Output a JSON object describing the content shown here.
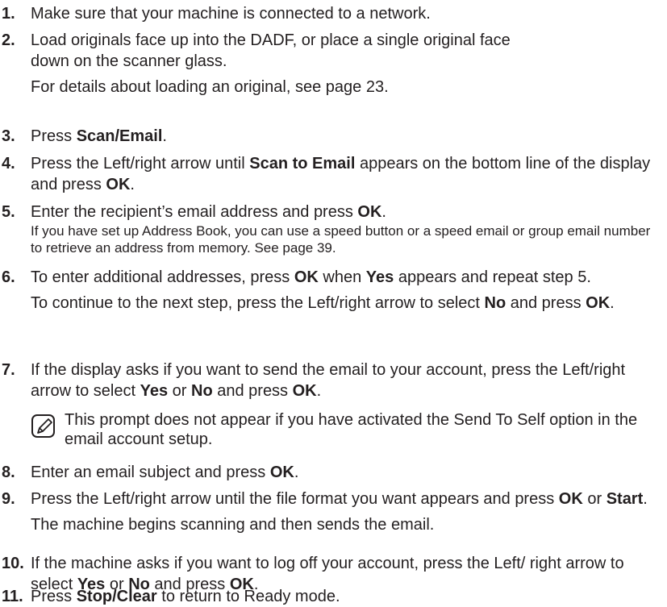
{
  "steps": [
    {
      "number": "1.",
      "text": "Make sure that your machine is connected to a network."
    },
    {
      "number": "2.",
      "line1": "Load originals face up into the DADF, or place a single original face",
      "line2": "down on the scanner glass.",
      "extra": "For details about loading an original, see page 23."
    },
    {
      "number": "3.",
      "pre": "Press ",
      "bold": "Scan/Email",
      "post": "."
    },
    {
      "number": "4.",
      "pre": "Press the Left/right arrow until ",
      "bold1": "Scan to Email",
      "mid": " appears on the bottom line of the display and press ",
      "bold2": "OK",
      "post": "."
    },
    {
      "number": "5.",
      "pre": "Enter the recipient’s email address and press ",
      "bold": "OK",
      "post": ".",
      "small": "If you have set up Address Book, you can use a speed button or a speed email or group email number to retrieve an address from memory. See page 39."
    },
    {
      "number": "6.",
      "pre": "To enter additional addresses, press ",
      "bold1": "OK",
      "mid": " when ",
      "bold2": "Yes",
      "post": " appears and repeat step 5.",
      "line2_pre": "To continue to the next step, press the Left/right arrow to select ",
      "line2_bold1": "No",
      "line2_mid": " and press ",
      "line2_bold2": "OK",
      "line2_post": "."
    },
    {
      "number": "7.",
      "pre": "If the display asks if you want to send the email to your account, press the Left/right arrow to select ",
      "bold1": "Yes",
      "mid1": " or ",
      "bold2": "No",
      "mid2": " and press ",
      "bold3": "OK",
      "post": "."
    },
    {
      "number": "8.",
      "pre": "Enter an email subject and press ",
      "bold": "OK",
      "post": "."
    },
    {
      "number": "9.",
      "pre": "Press the Left/right arrow until the file format you want appears and press ",
      "bold1": "OK",
      "mid": " or ",
      "bold2": "Start",
      "post": ".",
      "extra": "The machine begins scanning and then sends the email."
    },
    {
      "number": "10.",
      "pre": "If the machine asks if you want to log off your account, press the Left/ right arrow to select ",
      "bold1": "Yes",
      "mid1": " or ",
      "bold2": "No",
      "mid2": " and press ",
      "bold3": "OK",
      "post": "."
    },
    {
      "number": "11.",
      "pre": "Press ",
      "bold": "Stop/Clear",
      "post": " to return to Ready mode."
    }
  ],
  "note": {
    "text": "This prompt does not appear if you have activated the Send To Self option in the email account setup.",
    "icon": "note-pencil-icon"
  }
}
